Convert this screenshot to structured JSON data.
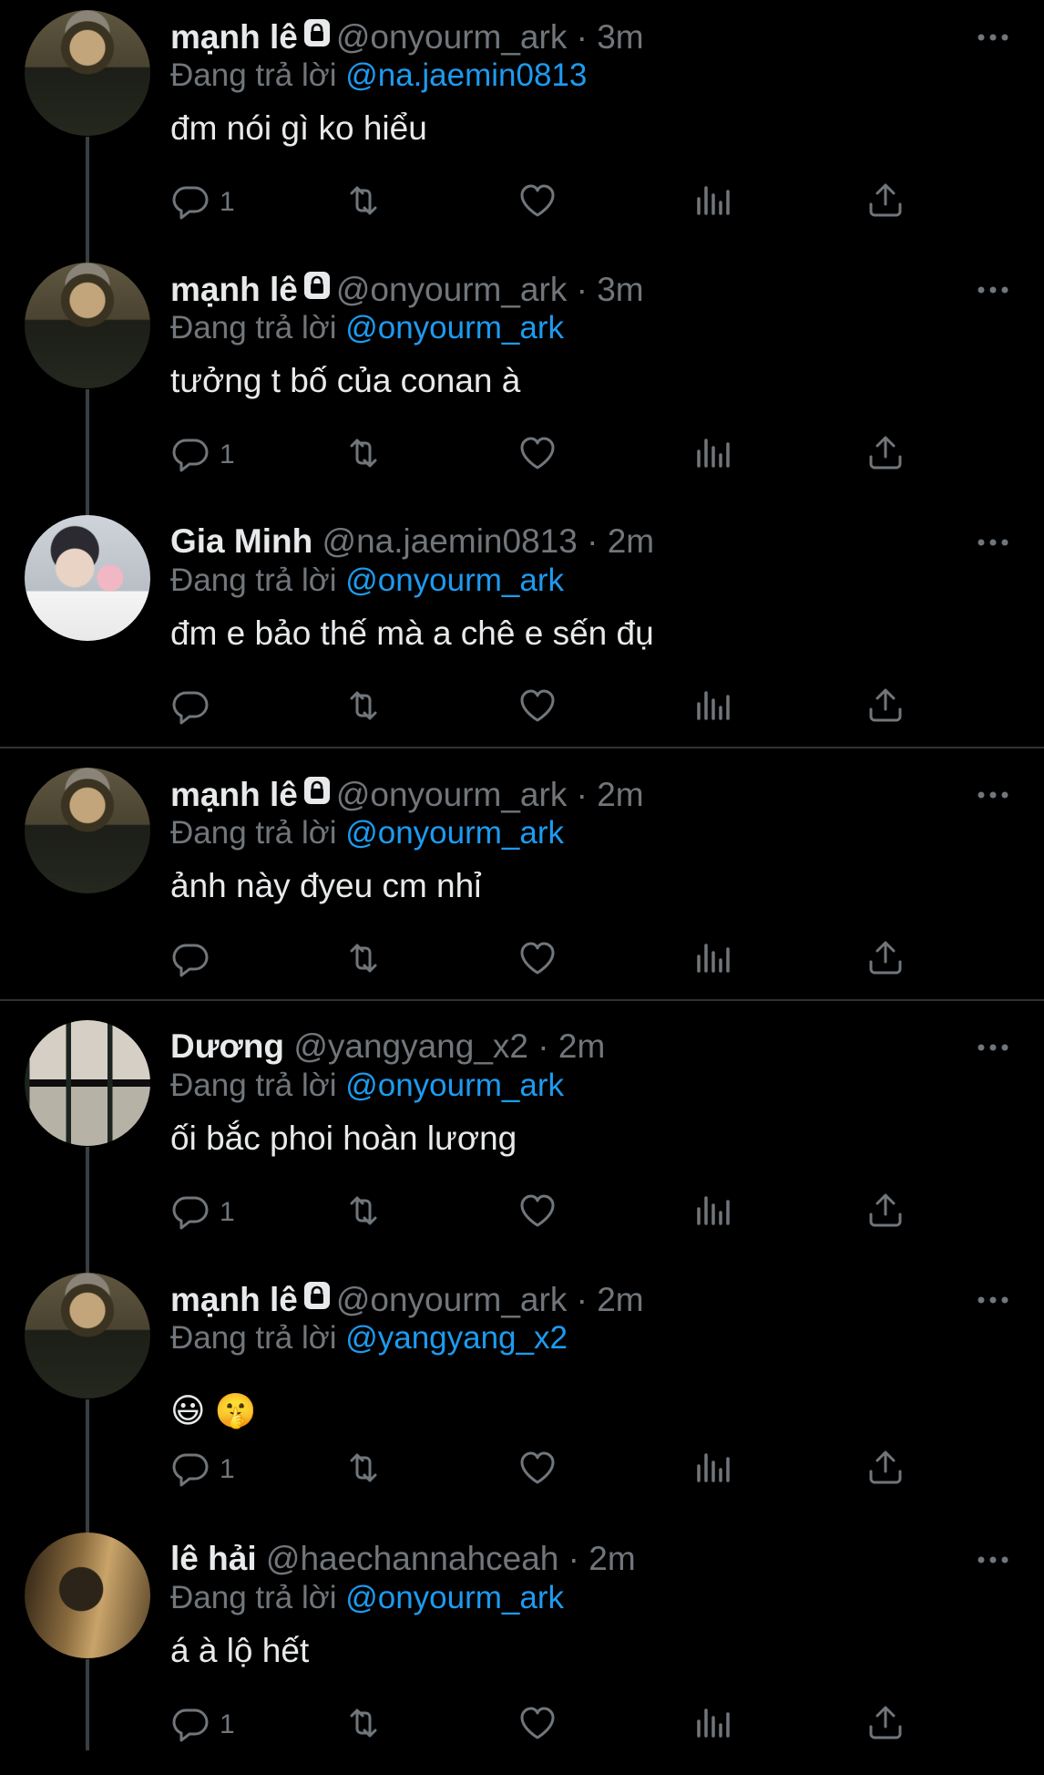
{
  "tweets": [
    {
      "name": "mạnh lê",
      "locked": true,
      "handle": "@onyourm_ark",
      "time": "3m",
      "replying_prefix": "Đang trả lời",
      "reply_to": "@na.jaemin0813",
      "text": "đm nói gì ko hiểu",
      "reply_count": "1",
      "avatar": "manh"
    },
    {
      "name": "mạnh lê",
      "locked": true,
      "handle": "@onyourm_ark",
      "time": "3m",
      "replying_prefix": "Đang trả lời",
      "reply_to": "@onyourm_ark",
      "text": "tưởng t bố của conan à",
      "reply_count": "1",
      "avatar": "manh"
    },
    {
      "name": "Gia Minh",
      "locked": false,
      "handle": "@na.jaemin0813",
      "time": "2m",
      "replying_prefix": "Đang trả lời",
      "reply_to": "@onyourm_ark",
      "text": "đm e bảo thế mà a chê e sến đụ",
      "reply_count": "",
      "avatar": "gia"
    },
    {
      "name": "mạnh lê",
      "locked": true,
      "handle": "@onyourm_ark",
      "time": "2m",
      "replying_prefix": "Đang trả lời",
      "reply_to": "@onyourm_ark",
      "text": "ảnh này đyeu cm nhỉ",
      "reply_count": "",
      "avatar": "manh"
    },
    {
      "name": "Dương",
      "locked": false,
      "handle": "@yangyang_x2",
      "time": "2m",
      "replying_prefix": "Đang trả lời",
      "reply_to": "@onyourm_ark",
      "text": "ối bắc phoi hoàn lương",
      "reply_count": "1",
      "avatar": "duong"
    },
    {
      "name": "mạnh lê",
      "locked": true,
      "handle": "@onyourm_ark",
      "time": "2m",
      "replying_prefix": "Đang trả lời",
      "reply_to": "@yangyang_x2",
      "text": "😃 🤫",
      "reply_count": "1",
      "avatar": "manh"
    },
    {
      "name": "lê hải",
      "locked": false,
      "handle": "@haechannahceah",
      "time": "2m",
      "replying_prefix": "Đang trả lời",
      "reply_to": "@onyourm_ark",
      "text": "á à lộ hết",
      "reply_count": "1",
      "avatar": "hai"
    }
  ],
  "separator": "·",
  "icons": {
    "reply": "reply-icon",
    "retweet": "retweet-icon",
    "like": "heart-icon",
    "views": "views-icon",
    "share": "share-icon",
    "more": "more-icon",
    "lock": "lock-icon"
  },
  "colors": {
    "background": "#000000",
    "text": "#e7e9ea",
    "muted": "#71767b",
    "link": "#1d9bf0"
  }
}
